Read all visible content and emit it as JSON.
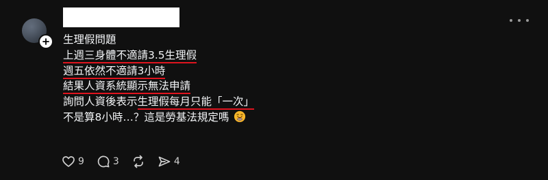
{
  "post": {
    "lines": [
      "生理假問題",
      "上週三身體不適請3.5生理假",
      "週五依然不適請3小時",
      "結果人資系統顯示無法申請",
      "詢問人資後表示",
      "生理假每月只能「一次」",
      "不是算8小時…？這是勞基法規定嗎"
    ],
    "emoji": "weary-face-emoji"
  },
  "actions": {
    "likes": "9",
    "comments": "3",
    "shares": "4"
  },
  "colors": {
    "background": "#101010",
    "text": "#f3f5f7",
    "underline": "#e0141e",
    "icon": "#d0d0d0"
  },
  "icons": [
    "plus-icon",
    "more-dots-icon",
    "heart-icon",
    "comment-icon",
    "repost-icon",
    "send-icon"
  ]
}
